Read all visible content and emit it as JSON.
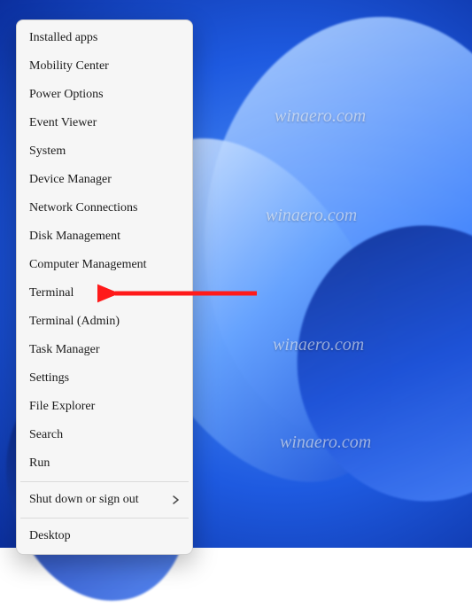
{
  "watermark_text": "winaero.com",
  "menu": {
    "groups": [
      {
        "items": [
          {
            "label": "Installed apps",
            "name": "menu-item-installed-apps",
            "submenu": false
          },
          {
            "label": "Mobility Center",
            "name": "menu-item-mobility-center",
            "submenu": false
          },
          {
            "label": "Power Options",
            "name": "menu-item-power-options",
            "submenu": false
          },
          {
            "label": "Event Viewer",
            "name": "menu-item-event-viewer",
            "submenu": false
          },
          {
            "label": "System",
            "name": "menu-item-system",
            "submenu": false
          },
          {
            "label": "Device Manager",
            "name": "menu-item-device-manager",
            "submenu": false
          },
          {
            "label": "Network Connections",
            "name": "menu-item-network-connections",
            "submenu": false
          },
          {
            "label": "Disk Management",
            "name": "menu-item-disk-management",
            "submenu": false
          },
          {
            "label": "Computer Management",
            "name": "menu-item-computer-management",
            "submenu": false
          },
          {
            "label": "Terminal",
            "name": "menu-item-terminal",
            "submenu": false
          },
          {
            "label": "Terminal (Admin)",
            "name": "menu-item-terminal-admin",
            "submenu": false
          },
          {
            "label": "Task Manager",
            "name": "menu-item-task-manager",
            "submenu": false
          },
          {
            "label": "Settings",
            "name": "menu-item-settings",
            "submenu": false
          },
          {
            "label": "File Explorer",
            "name": "menu-item-file-explorer",
            "submenu": false
          },
          {
            "label": "Search",
            "name": "menu-item-search",
            "submenu": false
          },
          {
            "label": "Run",
            "name": "menu-item-run",
            "submenu": false
          }
        ]
      },
      {
        "items": [
          {
            "label": "Shut down or sign out",
            "name": "menu-item-shutdown-signout",
            "submenu": true
          }
        ]
      },
      {
        "items": [
          {
            "label": "Desktop",
            "name": "menu-item-desktop",
            "submenu": false
          }
        ]
      }
    ]
  },
  "annotation": {
    "color": "#ff1a1a",
    "target_name": "menu-item-terminal"
  }
}
